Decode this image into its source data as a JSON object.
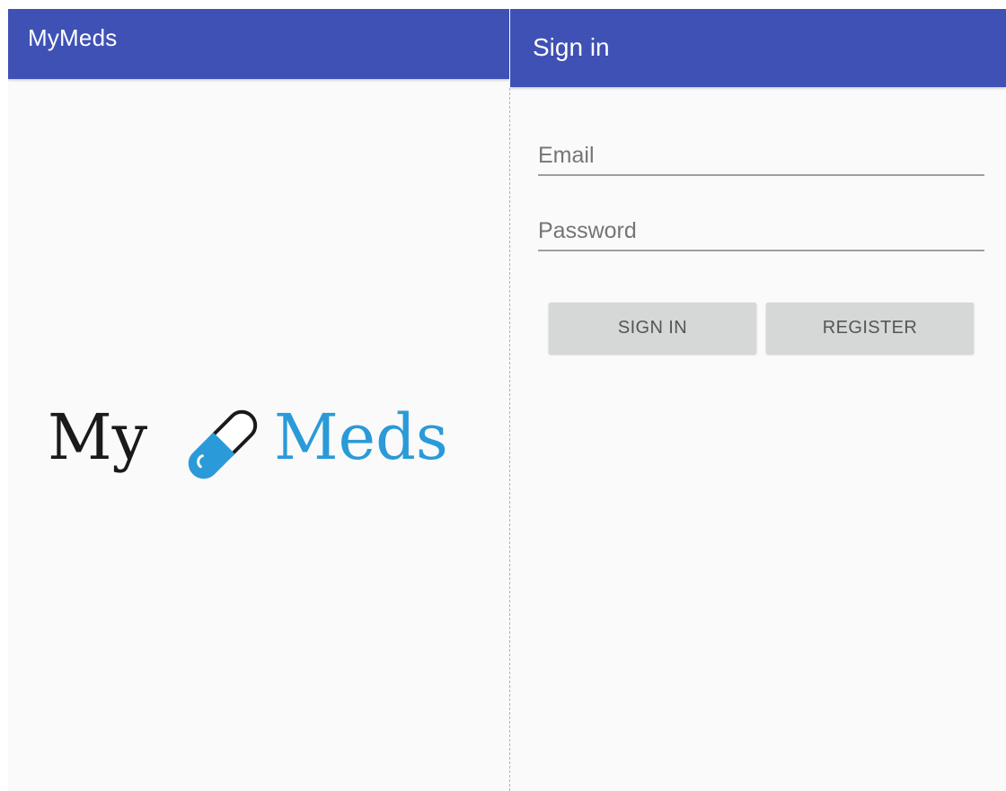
{
  "left_screen": {
    "app_title": "MyMeds",
    "logo": {
      "text_my": "My",
      "text_meds": "Meds",
      "icon": "pill-capsule-icon",
      "colors": {
        "dark": "#1a1a1a",
        "accent": "#2a9ad8"
      }
    }
  },
  "right_screen": {
    "app_title": "Sign in",
    "email": {
      "placeholder": "Email",
      "value": ""
    },
    "password": {
      "placeholder": "Password",
      "value": ""
    },
    "buttons": {
      "sign_in": "SIGN IN",
      "register": "REGISTER"
    }
  },
  "colors": {
    "app_bar": "#3f51b5",
    "background": "#fafafa",
    "button_bg": "#d6d7d7",
    "button_text": "#555555",
    "underline": "#9e9e9e"
  }
}
